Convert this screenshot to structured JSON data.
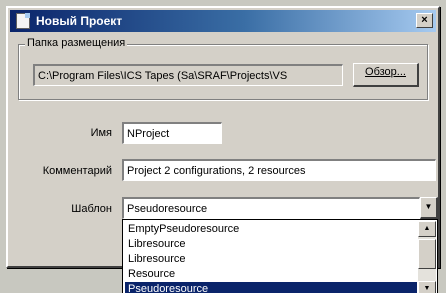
{
  "window": {
    "title": "Новый Проект",
    "close_label": "×"
  },
  "location": {
    "group_label": "Папка размещения",
    "path": "C:\\Program Files\\ICS Tapes (Sa\\SRAF\\Projects\\VS",
    "browse_label": "Обзор..."
  },
  "name": {
    "label": "Имя",
    "value": "NProject"
  },
  "comment": {
    "label": "Комментарий",
    "value": "Project 2 configurations, 2 resources"
  },
  "template": {
    "label": "Шаблон",
    "selected": "Pseudoresource",
    "arrow": "▼",
    "options": [
      "EmptyPseudoresource",
      "Libresource",
      "Libresource",
      "Resource",
      "Pseudoresource"
    ],
    "scroll_up": "▲",
    "scroll_down": "▼"
  }
}
